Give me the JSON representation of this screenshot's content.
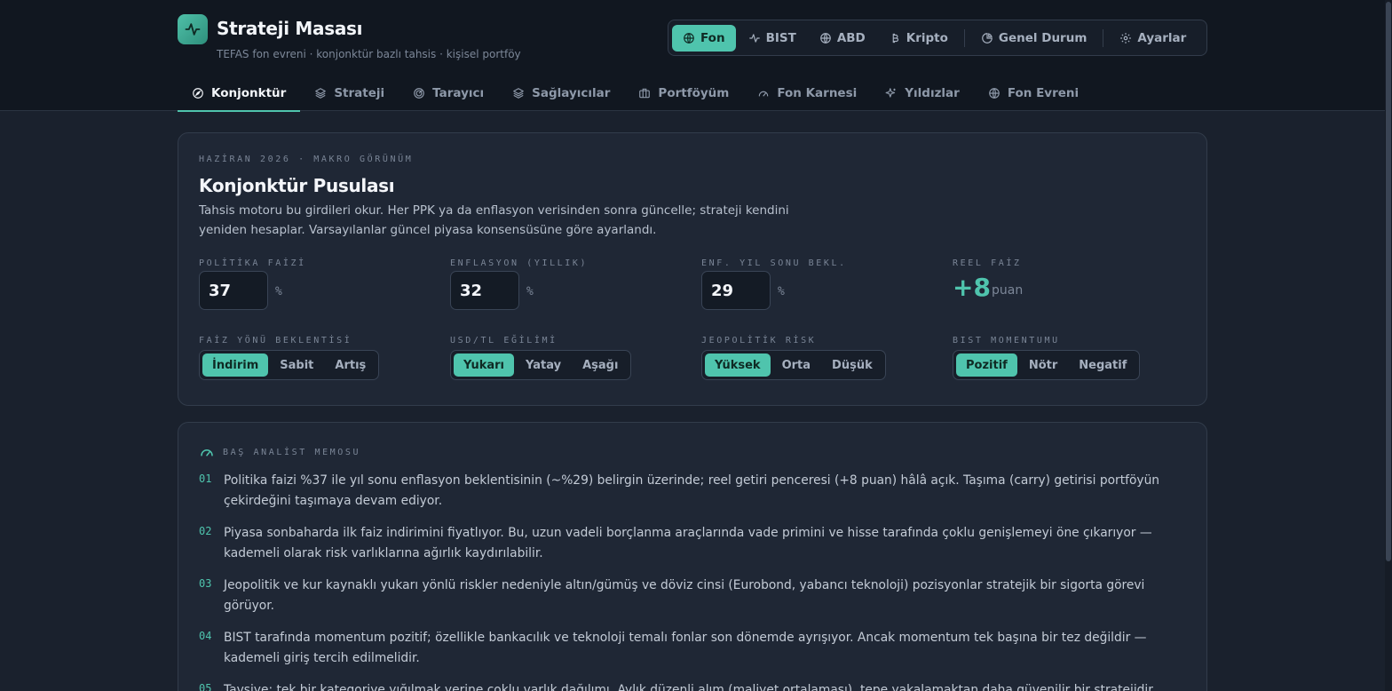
{
  "brand": {
    "title": "Strateji Masası",
    "subtitle": "TEFAS fon evreni · konjonktür bazlı tahsis · kişisel portföy",
    "logo_icon": "pulse-icon"
  },
  "market_switcher": {
    "items": [
      {
        "label": "Fon",
        "icon": "globe-icon",
        "active": true
      },
      {
        "label": "BIST",
        "icon": "activity-icon",
        "active": false
      },
      {
        "label": "ABD",
        "icon": "globe-icon",
        "active": false
      },
      {
        "label": "Kripto",
        "icon": "bitcoin-icon",
        "active": false
      }
    ],
    "genel_durum": "Genel Durum",
    "ayarlar": "Ayarlar"
  },
  "tabs": [
    {
      "label": "Konjonktür",
      "icon": "compass-icon",
      "active": true
    },
    {
      "label": "Strateji",
      "icon": "layers-icon",
      "active": false
    },
    {
      "label": "Tarayıcı",
      "icon": "radar-icon",
      "active": false
    },
    {
      "label": "Sağlayıcılar",
      "icon": "layers-icon",
      "active": false
    },
    {
      "label": "Portföyüm",
      "icon": "briefcase-icon",
      "active": false
    },
    {
      "label": "Fon Karnesi",
      "icon": "gauge-icon",
      "active": false
    },
    {
      "label": "Yıldızlar",
      "icon": "sparkles-icon",
      "active": false
    },
    {
      "label": "Fon Evreni",
      "icon": "globe-icon",
      "active": false
    }
  ],
  "compass": {
    "eyebrow": "HAZİRAN 2026 · MAKRO GÖRÜNÜM",
    "title": "Konjonktür Pusulası",
    "description": "Tahsis motoru bu girdileri okur. Her PPK ya da enflasyon verisinden sonra güncelle; strateji kendini yeniden hesaplar. Varsayılanlar güncel piyasa konsensüsüne göre ayarlandı.",
    "policy_rate": {
      "label": "POLİTİKA FAİZİ",
      "value": "37",
      "unit": "%"
    },
    "inflation": {
      "label": "ENFLASYON (YILLIK)",
      "value": "32",
      "unit": "%"
    },
    "inflation_expectation": {
      "label": "ENF. YIL SONU BEKL.",
      "value": "29",
      "unit": "%"
    },
    "real_rate": {
      "label": "REEL FAİZ",
      "value": "+8",
      "unit": "puan"
    },
    "rate_direction": {
      "label": "FAİZ YÖNÜ BEKLENTİSİ",
      "options": [
        "İndirim",
        "Sabit",
        "Artış"
      ],
      "selected": 0
    },
    "usd_try": {
      "label": "USD/TL EĞİLİMİ",
      "options": [
        "Yukarı",
        "Yatay",
        "Aşağı"
      ],
      "selected": 0
    },
    "geo_risk": {
      "label": "JEOPOLİTİK RİSK",
      "options": [
        "Yüksek",
        "Orta",
        "Düşük"
      ],
      "selected": 0
    },
    "bist_momentum": {
      "label": "BIST MOMENTUMU",
      "options": [
        "Pozitif",
        "Nötr",
        "Negatif"
      ],
      "selected": 0
    }
  },
  "memo": {
    "eyebrow": "BAŞ ANALİST MEMOSU",
    "icon": "gauge-icon",
    "items": [
      {
        "num": "01",
        "text": "Politika faizi %37 ile yıl sonu enflasyon beklentisinin (~%29) belirgin üzerinde; reel getiri penceresi (+8 puan) hâlâ açık. Taşıma (carry) getirisi portföyün çekirdeğini taşımaya devam ediyor."
      },
      {
        "num": "02",
        "text": "Piyasa sonbaharda ilk faiz indirimini fiyatlıyor. Bu, uzun vadeli borçlanma araçlarında vade primini ve hisse tarafında çoklu genişlemeyi öne çıkarıyor — kademeli olarak risk varlıklarına ağırlık kaydırılabilir."
      },
      {
        "num": "03",
        "text": "Jeopolitik ve kur kaynaklı yukarı yönlü riskler nedeniyle altın/gümüş ve döviz cinsi (Eurobond, yabancı teknoloji) pozisyonlar stratejik bir sigorta görevi görüyor."
      },
      {
        "num": "04",
        "text": "BIST tarafında momentum pozitif; özellikle bankacılık ve teknoloji temalı fonlar son dönemde ayrışıyor. Ancak momentum tek başına bir tez değildir — kademeli giriş tercih edilmelidir."
      },
      {
        "num": "05",
        "text": "Tavsiye: tek bir kategoriye yığılmak yerine çoklu varlık dağılımı. Aylık düzenli alım (maliyet ortalaması), tepe yakalamaktan daha güvenilir bir stratejidir."
      }
    ]
  }
}
